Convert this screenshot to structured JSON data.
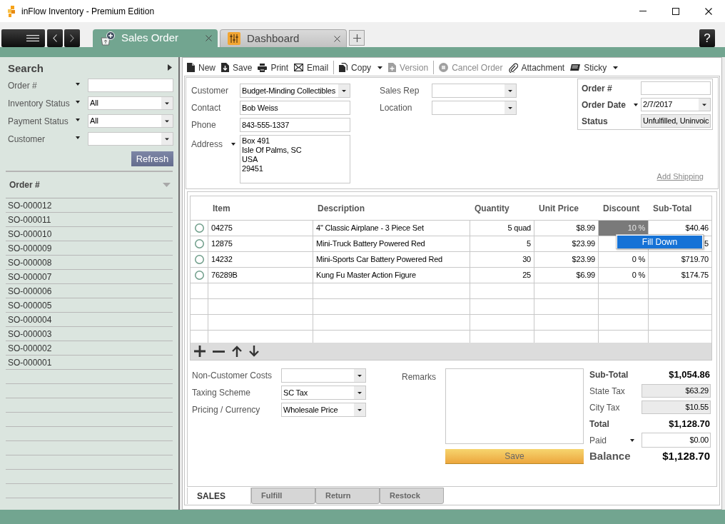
{
  "window": {
    "title": "inFlow Inventory - Premium Edition"
  },
  "tabs": [
    {
      "label": "Sales Order",
      "selected": true
    },
    {
      "label": "Dashboard",
      "selected": false
    }
  ],
  "help_button": "?",
  "sidebar": {
    "title": "Search",
    "filters": [
      {
        "label": "Order #",
        "label_menu": true,
        "kind": "text"
      },
      {
        "label": "Inventory Status",
        "label_menu": true,
        "kind": "dropdown",
        "value": "All"
      },
      {
        "label": "Payment Status",
        "label_menu": true,
        "kind": "dropdown",
        "value": "All"
      },
      {
        "label": "Customer",
        "label_menu": true,
        "kind": "dropdown"
      }
    ],
    "refresh_button": "Refresh",
    "list_header": "Order #",
    "orders": [
      {
        "number": "SO-000012",
        "selected": false
      },
      {
        "number": "SO-000011",
        "selected": false
      },
      {
        "number": "SO-000010",
        "selected": false
      },
      {
        "number": "SO-000009",
        "selected": false
      },
      {
        "number": "SO-000008",
        "selected": false
      },
      {
        "number": "SO-000007",
        "selected": false
      },
      {
        "number": "SO-000006",
        "selected": false
      },
      {
        "number": "SO-000005",
        "selected": false
      },
      {
        "number": "SO-000004",
        "selected": false
      },
      {
        "number": "SO-000003",
        "selected": false
      },
      {
        "number": "SO-000002",
        "selected": false
      },
      {
        "number": "SO-000001",
        "selected": false
      }
    ]
  },
  "toolbar": [
    {
      "items": [
        {
          "label": "New",
          "disabled": false,
          "menu": false
        },
        {
          "label": "Save",
          "disabled": false,
          "menu": false
        },
        {
          "label": "Print",
          "disabled": false,
          "menu": false
        },
        {
          "label": "Email",
          "disabled": false,
          "menu": false
        }
      ]
    },
    {
      "items": [
        {
          "label": "Copy",
          "disabled": false,
          "menu": true
        },
        {
          "label": "Version",
          "disabled": true,
          "menu": false
        }
      ]
    },
    {
      "items": [
        {
          "label": "Cancel Order",
          "disabled": true,
          "menu": false
        },
        {
          "label": "Attachment",
          "disabled": false,
          "menu": false
        },
        {
          "label": "Sticky",
          "disabled": false,
          "menu": true
        }
      ]
    }
  ],
  "order_form": {
    "customer_fields": [
      {
        "label": "Customer",
        "label_menu": false,
        "kind": "dropdown",
        "value": "Budget-Minding Collectibles"
      },
      {
        "label": "Contact",
        "label_menu": false,
        "kind": "text",
        "value": "Bob Weiss"
      },
      {
        "label": "Phone",
        "label_menu": false,
        "kind": "text",
        "value": "843-555-1337"
      },
      {
        "label": "Address",
        "label_menu": true,
        "kind": "textarea",
        "lines": [
          "Box 491",
          "Isle Of Palms, SC",
          "USA",
          "29451"
        ]
      }
    ],
    "sales_fields": [
      {
        "label": "Sales Rep",
        "kind": "dropdown"
      },
      {
        "label": "Location",
        "kind": "dropdown"
      }
    ],
    "order_fields": [
      {
        "label": "Order #",
        "label_menu": false,
        "kind": "text"
      },
      {
        "label": "Order Date",
        "label_menu": true,
        "kind": "dropdown",
        "value": "2/7/2017"
      },
      {
        "label": "Status",
        "label_menu": false,
        "kind": "readonly",
        "value": "Unfulfilled, Uninvoic"
      }
    ],
    "add_shipping": "Add Shipping"
  },
  "table": {
    "columns": [
      "Item",
      "Description",
      "Quantity",
      "Unit Price",
      "Discount",
      "Sub-Total"
    ],
    "rows": [
      {
        "selected": false,
        "cells": [
          {
            "text": "04275",
            "focused": false
          },
          {
            "text": "4\" Classic Airplane - 3 Piece Set",
            "focused": false
          },
          {
            "text": "5 quad",
            "focused": false
          },
          {
            "text": "$8.99",
            "focused": false
          },
          {
            "text": "10 %",
            "focused": true
          },
          {
            "text": "$40.46",
            "focused": false
          }
        ]
      },
      {
        "selected": false,
        "cells": [
          {
            "text": "12875",
            "focused": false
          },
          {
            "text": "Mini-Truck Battery Powered Red",
            "focused": false
          },
          {
            "text": "5",
            "focused": false
          },
          {
            "text": "$23.99",
            "focused": false
          },
          {
            "focused": false
          },
          {
            "text": "5",
            "focused": false
          }
        ]
      },
      {
        "selected": false,
        "cells": [
          {
            "text": "14232",
            "focused": false
          },
          {
            "text": "Mini-Sports Car Battery Powered Red",
            "focused": false
          },
          {
            "text": "30",
            "focused": false
          },
          {
            "text": "$23.99",
            "focused": false
          },
          {
            "text": "0 %",
            "focused": false
          },
          {
            "text": "$719.70",
            "focused": false
          }
        ]
      },
      {
        "selected": false,
        "cells": [
          {
            "text": "76289B",
            "focused": false
          },
          {
            "text": "Kung Fu Master Action Figure",
            "focused": false
          },
          {
            "text": "25",
            "focused": false
          },
          {
            "text": "$6.99",
            "focused": false
          },
          {
            "text": "0 %",
            "focused": false
          },
          {
            "text": "$174.75",
            "focused": false
          }
        ]
      }
    ],
    "context_menu": {
      "items": [
        {
          "label": "Fill Down",
          "selected": true
        }
      ]
    }
  },
  "costs": [
    {
      "label": "Non-Customer Costs",
      "kind": "dropdown"
    },
    {
      "label": "Taxing Scheme",
      "kind": "dropdown",
      "value": "SC Tax"
    },
    {
      "label": "Pricing / Currency",
      "kind": "dropdown",
      "value": "Wholesale Price"
    }
  ],
  "remarks": {
    "label": "Remarks",
    "save_button": "Save"
  },
  "totals": [
    {
      "label": "Sub-Total",
      "label_menu": false,
      "kind": "sum",
      "value": "$1,054.86"
    },
    {
      "label": "State Tax",
      "label_menu": false,
      "kind": "readonly",
      "value": "$63.29"
    },
    {
      "label": "City Tax",
      "label_menu": false,
      "kind": "readonly",
      "value": "$10.55"
    },
    {
      "label": "Total",
      "label_menu": false,
      "kind": "sum",
      "value": "$1,128.70"
    },
    {
      "label": "Paid",
      "label_menu": true,
      "kind": "text",
      "value": "$0.00"
    },
    {
      "label": "Balance",
      "label_menu": false,
      "kind": "balance",
      "value": "$1,128.70"
    }
  ],
  "bottom_tabs": [
    {
      "label": "SALES",
      "selected": true
    },
    {
      "label": "Fulfill",
      "selected": false
    },
    {
      "label": "Return",
      "selected": false
    },
    {
      "label": "Restock",
      "selected": false
    }
  ]
}
